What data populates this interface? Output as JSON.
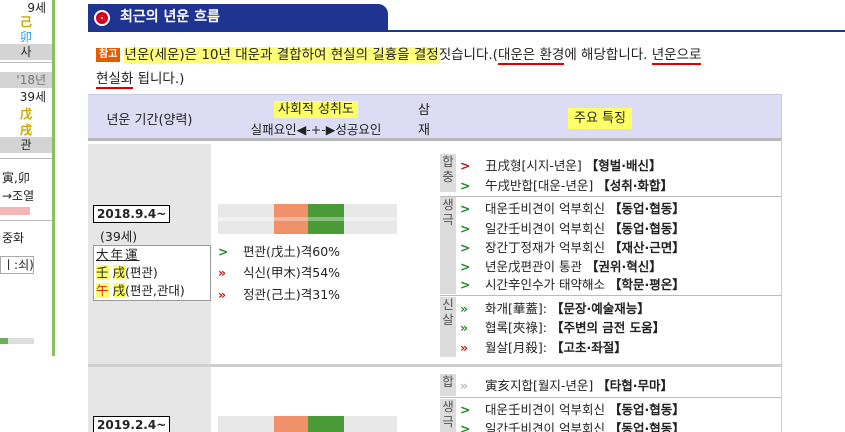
{
  "sidebar": {
    "cells": [
      "9세",
      "己",
      "卯",
      "사",
      "'18년",
      "39세",
      "戊",
      "戌",
      "관",
      "寅,卯",
      "→조열",
      "중화",
      "ㅣ:쇠)"
    ]
  },
  "header": {
    "title": "최근의 년운 흐름"
  },
  "note": {
    "tag": "참고",
    "part1": "년운(세운)은 10년 대운과 결합하여 현실의 길흉을 결정",
    "part2": "짓습니다.(",
    "part3": "대운은 환경",
    "part4": "에 해당합니다. ",
    "part5": "년운으로",
    "part6": "현실화",
    "part7": " 됩니다.)"
  },
  "table": {
    "col_period": "년운 기간(양력)",
    "col_achieve": "사회적 성취도",
    "col_achieve_sub": "실패요인◀-+-▶성공요인",
    "col_samjae_1": "삼",
    "col_samjae_2": "재",
    "col_features": "주요 특징"
  },
  "rows": [
    {
      "date": "2018.9.4~",
      "age": "(39세)",
      "ganji": {
        "title": "大年運",
        "line1_char": "壬",
        "line1_rest_char": "戌",
        "line1_note": "(편관)",
        "line2_char": "午",
        "line2_rest_char": "戌",
        "line2_note": "(편관,관대)"
      },
      "scores": [
        {
          "arrow": ">",
          "arrow_color": "green",
          "text": "편관(戊土)격60%"
        },
        {
          "arrow": "»",
          "arrow_color": "red",
          "text": "식신(甲木)격54%"
        },
        {
          "arrow": "»",
          "arrow_color": "red",
          "text": "정관(己土)격31%"
        }
      ],
      "groups": [
        {
          "label": "합충",
          "items": [
            {
              "arrow": ">",
              "arrow_color": "red",
              "text": "丑戌형[시지-년운] ",
              "bold": "【형벌·배신】"
            },
            {
              "arrow": ">",
              "arrow_color": "green",
              "text": "午戌반합[대운-년운] ",
              "bold": "【성취·화합】"
            }
          ]
        },
        {
          "label": "생극",
          "items": [
            {
              "arrow": ">",
              "arrow_color": "green",
              "text": "대운壬비견이 억부회신 ",
              "bold": "【동업·협동】"
            },
            {
              "arrow": ">",
              "arrow_color": "green",
              "text": "일간壬비견이 억부회신 ",
              "bold": "【동업·협동】"
            },
            {
              "arrow": ">",
              "arrow_color": "green",
              "text": "장간丁정재가 억부회신 ",
              "bold": "【재산·근면】"
            },
            {
              "arrow": ">",
              "arrow_color": "green",
              "text": "년운戊편관이 통관 ",
              "bold": "【권위·혁신】"
            },
            {
              "arrow": ">",
              "arrow_color": "green",
              "text": "시간辛인수가 태약해소 ",
              "bold": "【학문·평온】"
            }
          ]
        },
        {
          "label": "신살",
          "items": [
            {
              "arrow": "»",
              "arrow_color": "green",
              "text": "화개[華蓋]: ",
              "bold": "【문장·예술재능】"
            },
            {
              "arrow": "»",
              "arrow_color": "green",
              "text": "협록[夾祿]: ",
              "bold": "【주변의 금전 도움】"
            },
            {
              "arrow": "»",
              "arrow_color": "red",
              "text": "월살[月殺]: ",
              "bold": "【고초·좌절】"
            }
          ]
        }
      ]
    },
    {
      "date": "2019.2.4~",
      "groups": [
        {
          "label": "합",
          "items": [
            {
              "arrow": "»",
              "arrow_color": "gray",
              "text": "寅亥지합[월지-년운] ",
              "bold": "【타협·무마】"
            }
          ]
        },
        {
          "label": "생극",
          "items": [
            {
              "arrow": ">",
              "arrow_color": "green",
              "text": "대운壬비견이 억부회신 ",
              "bold": "【동업·협동】"
            },
            {
              "arrow": ">",
              "arrow_color": "green",
              "text": "일간壬비견이 억부회신 ",
              "bold": "【동업·협동】"
            }
          ]
        }
      ]
    }
  ],
  "colors": {
    "header_bg": "#1f3490",
    "highlight": "#ffff66",
    "table_head_bg": "#dcdcf5",
    "success_green": "#20882a",
    "fail_red": "#cc1111",
    "bar_red": "#f0906a",
    "bar_green": "#4a9a3a"
  }
}
